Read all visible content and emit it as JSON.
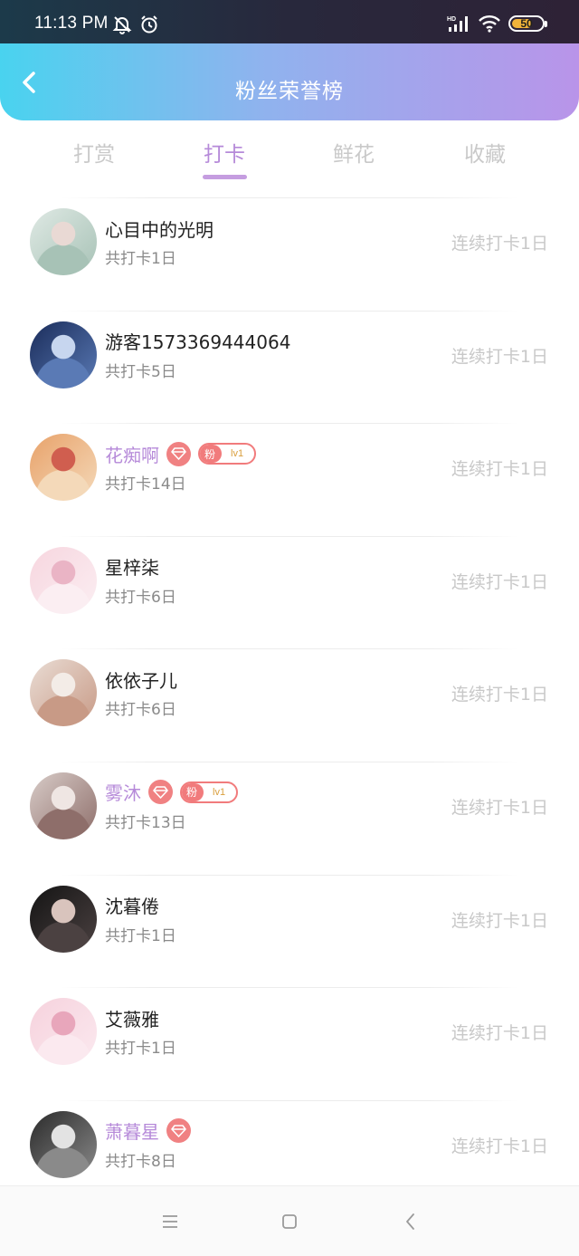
{
  "status_bar": {
    "time": "11:13 PM",
    "battery": "50",
    "network": "HD"
  },
  "header": {
    "title": "粉丝荣誉榜",
    "back_icon": "chevron-left-icon"
  },
  "tabs": [
    {
      "label": "打赏",
      "active": false
    },
    {
      "label": "打卡",
      "active": true
    },
    {
      "label": "鲜花",
      "active": false
    },
    {
      "label": "收藏",
      "active": false
    }
  ],
  "fans": [
    {
      "name": "心目中的光明",
      "total": "共打卡1日",
      "streak": "连续打卡1日",
      "vip": false,
      "fan_badge": false,
      "avatar_colors": [
        "#dfe9e4",
        "#a7c2b6",
        "#e9d9d4"
      ]
    },
    {
      "name": "游客1573369444064",
      "total": "共打卡5日",
      "streak": "连续打卡1日",
      "vip": false,
      "fan_badge": false,
      "avatar_colors": [
        "#1a2c5a",
        "#5a7ab5",
        "#c7d6ef"
      ]
    },
    {
      "name": "花痴啊",
      "total": "共打卡14日",
      "streak": "连续打卡1日",
      "vip": true,
      "fan_badge": true,
      "avatar_colors": [
        "#e8a26a",
        "#f4d9b9",
        "#d05e4f"
      ]
    },
    {
      "name": "星梓柒",
      "total": "共打卡6日",
      "streak": "连续打卡1日",
      "vip": false,
      "fan_badge": false,
      "avatar_colors": [
        "#f7d6df",
        "#fbeef2",
        "#eab4c5"
      ]
    },
    {
      "name": "依依子儿",
      "total": "共打卡6日",
      "streak": "连续打卡1日",
      "vip": false,
      "fan_badge": false,
      "avatar_colors": [
        "#e9dcd4",
        "#c89a86",
        "#f3ece7"
      ]
    },
    {
      "name": "雾沐",
      "total": "共打卡13日",
      "streak": "连续打卡1日",
      "vip": true,
      "fan_badge": true,
      "avatar_colors": [
        "#d8ccc8",
        "#8e6e6a",
        "#efe6e3"
      ]
    },
    {
      "name": "沈暮倦",
      "total": "共打卡1日",
      "streak": "连续打卡1日",
      "vip": false,
      "fan_badge": false,
      "avatar_colors": [
        "#141414",
        "#4b4141",
        "#d9c4bd"
      ]
    },
    {
      "name": "艾薇雅",
      "total": "共打卡1日",
      "streak": "连续打卡1日",
      "vip": false,
      "fan_badge": false,
      "avatar_colors": [
        "#f6d2dd",
        "#fbe9ef",
        "#e8a6bb"
      ]
    },
    {
      "name": "萧暮星",
      "total": "共打卡8日",
      "streak": "连续打卡1日",
      "vip": true,
      "fan_badge": false,
      "avatar_colors": [
        "#2a2a2a",
        "#8a8a8a",
        "#e3e3e3"
      ]
    }
  ],
  "fan_badge": {
    "left": "粉",
    "right": "lv1"
  },
  "colors": {
    "accent": "#b68ad9",
    "badge": "#f17b7c",
    "header_start": "#49d3ef",
    "header_end": "#b994e9"
  },
  "navbar": {
    "icons": [
      "menu-icon",
      "home-square-icon",
      "back-triangle-icon"
    ]
  }
}
